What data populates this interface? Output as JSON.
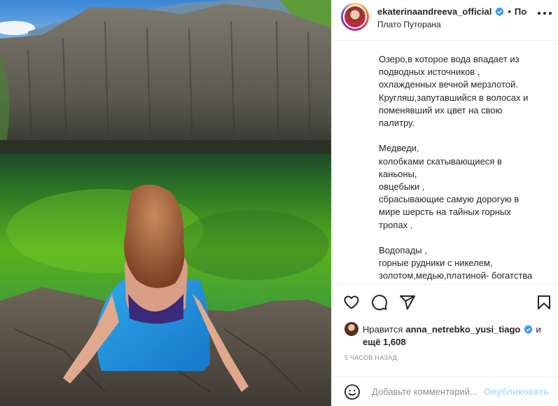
{
  "post": {
    "username": "ekaterinaandreeva_official",
    "separator": "•",
    "follow_label": "По",
    "location": "Плато Путорана",
    "caption_lines": [
      "Озеро,в которое вода впадает из",
      "подводных источников ,",
      "охлажденных вечной мерзлотой.",
      "Кругляш,запутавшийся в волосах и",
      "поменявший их цвет на свою",
      "палитру.",
      "",
      "Медведи,",
      "колобками скатывающиеся в",
      "каньоны,",
      "овцебыки ,",
      "сбрасывающие самую дорогую в",
      "мире шерсть на тайных горных",
      "тропах .",
      "",
      "Водопады ,",
      "горные рудники с никелем,",
      "золотом,медью,платиной- богатства"
    ],
    "likes": {
      "prefix": "Нравится",
      "liker": "anna_netrebko_yusi_tiago",
      "conjunction": "и",
      "others": "ещё 1,608"
    },
    "time_ago": "5 часов назад",
    "comment": {
      "placeholder": "Добавьте комментарий...",
      "publish_label": "Опубликовать"
    }
  },
  "icons": {
    "verified": "verified-badge-icon",
    "more": "more-options-icon",
    "like": "heart-icon",
    "comment": "comment-bubble-icon",
    "share": "paper-plane-icon",
    "save": "bookmark-icon",
    "emoji": "emoji-smiley-icon"
  },
  "colors": {
    "verified": "#3897f0",
    "publish_disabled": "#b2dffc",
    "muted_text": "#8e8e8e",
    "divider": "#efefef"
  }
}
